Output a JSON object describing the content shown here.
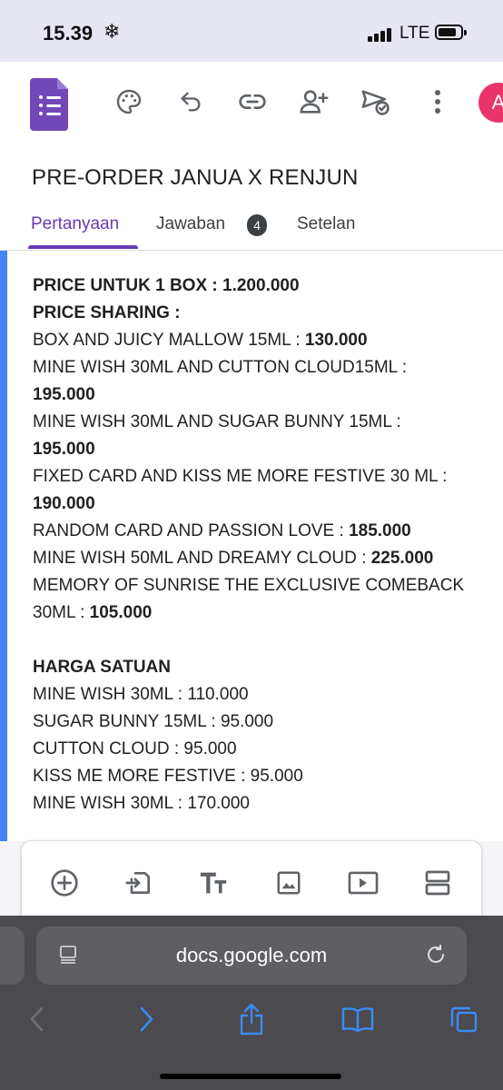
{
  "status_bar": {
    "time": "15.39",
    "snow_glyph": "❄",
    "network": "LTE"
  },
  "toolbar": {
    "icons": [
      "palette-icon",
      "undo-icon",
      "link-icon",
      "add-collaborator-icon",
      "send-icon",
      "more-vert-icon"
    ],
    "avatar_initial": "A",
    "avatar_color": "#e8336b"
  },
  "form": {
    "title": "PRE-ORDER JANUA X RENJUN"
  },
  "tabs": {
    "questions": "Pertanyaan",
    "responses": "Jawaban",
    "responses_count": "4",
    "settings": "Setelan"
  },
  "description": {
    "price_box_label": "PRICE UNTUK 1 BOX : 1.200.000",
    "price_sharing_label": "PRICE SHARING :",
    "sharing_1_text": "BOX AND JUICY MALLOW 15ML : ",
    "sharing_1_price": "130.000",
    "sharing_2_text": "MINE WISH 30ML AND CUTTON CLOUD15ML  :",
    "sharing_2_price": "195.000",
    "sharing_3_text": "MINE WISH 30ML AND SUGAR BUNNY 15ML :",
    "sharing_3_price": "195.000",
    "sharing_4_text": "FIXED CARD AND KISS ME MORE FESTIVE 30 ML :",
    "sharing_4_price": "190.000",
    "sharing_5_text": "RANDOM CARD AND PASSION LOVE : ",
    "sharing_5_price": "185.000",
    "sharing_6_text": "MINE WISH 50ML AND DREAMY CLOUD : ",
    "sharing_6_price": "225.000",
    "sharing_7_text": "MEMORY OF SUNRISE THE EXCLUSIVE COMEBACK",
    "sharing_7_text_cont": "30ML : ",
    "sharing_7_price": "105.000",
    "unit_label": "HARGA SATUAN",
    "unit_1": "MINE WISH 30ML : 110.000",
    "unit_2": "SUGAR BUNNY 15ML : 95.000",
    "unit_3": "CUTTON CLOUD : 95.000",
    "unit_4": "KISS ME MORE FESTIVE : 95.000",
    "unit_5": "MINE WISH 30ML : 170.000"
  },
  "add_bar": {
    "icons": [
      "add-question-icon",
      "import-questions-icon",
      "add-title-icon",
      "add-image-icon",
      "add-video-icon",
      "add-section-icon"
    ]
  },
  "safari": {
    "url": "docs.google.com",
    "icons": [
      "back-icon",
      "forward-icon",
      "share-icon",
      "bookmarks-icon",
      "tabs-icon"
    ]
  },
  "colors": {
    "accent_purple": "#673ab7",
    "card_border_blue": "#4285f4",
    "safari_blue": "#3b8bf5"
  }
}
